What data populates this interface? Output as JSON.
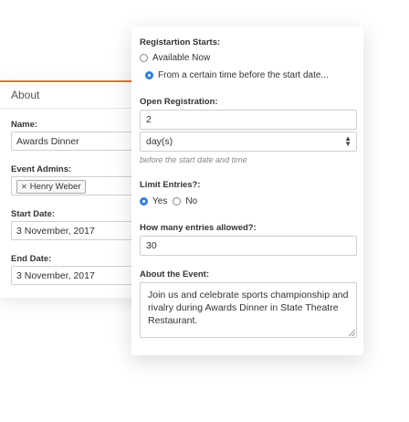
{
  "about": {
    "title": "About",
    "name_label": "Name:",
    "name_value": "Awards Dinner",
    "admins_label": "Event Admins:",
    "admin_chip": "Henry Weber",
    "start_label": "Start Date:",
    "start_value": "3 November, 2017",
    "end_label": "End Date:",
    "end_value": "3 November, 2017"
  },
  "form": {
    "reg_starts_label": "Registartion Starts:",
    "opt_available": "Available Now",
    "opt_certain": "From a certain time before the start date...",
    "open_reg_label": "Open Registration:",
    "open_reg_value": "2",
    "unit_value": "day(s)",
    "hint": "before the start date and time",
    "limit_label": "Limit Entries?:",
    "yes": "Yes",
    "no": "No",
    "entries_label": "How many entries allowed?:",
    "entries_value": "30",
    "about_event_label": "About the Event:",
    "about_event_value": "Join us and celebrate sports championship and rivalry during Awards Dinner in State Theatre Restaurant."
  },
  "colors": {
    "accent": "#e8722a",
    "radio_selected": "#2f80d8"
  }
}
